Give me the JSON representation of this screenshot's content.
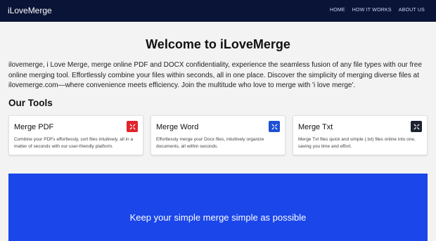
{
  "nav": {
    "brand": "iLoveMerge",
    "links": [
      "HOME",
      "HOW IT WORKS",
      "ABOUT US"
    ]
  },
  "main": {
    "title": "Welcome to iLoveMerge",
    "intro": "ilovemerge, i Love Merge, merge online PDF and DOCX confidentiality, experience the seamless fusion of any file types with our free online merging tool. Effortlessly combine your files within seconds, all in one place. Discover the simplicity of merging diverse files at ilovemerge.com—where convenience meets efficiency. Join the multitude who love to merge with 'i love merge'.",
    "tools_heading": "Our Tools"
  },
  "tools": [
    {
      "title": "Merge PDF",
      "description": "Combine your PDFs effortlessly, sort files intuitively, all in a matter of seconds with our user-friendly platform.",
      "icon": "merge-pdf-icon",
      "color": "#e0242b"
    },
    {
      "title": "Merge Word",
      "description": "Effortlessly merge your Docx files, intuitively organize documents, all within seconds.",
      "icon": "merge-word-icon",
      "color": "#1f4fd6"
    },
    {
      "title": "Merge Txt",
      "description": "Merge Txt files quick and simple (.txt) files online into one, saving you time and effort.",
      "icon": "merge-txt-icon",
      "color": "#1c2230"
    }
  ],
  "hero": {
    "text": "Keep your simple merge simple as possible",
    "color": "#1a46ea"
  }
}
